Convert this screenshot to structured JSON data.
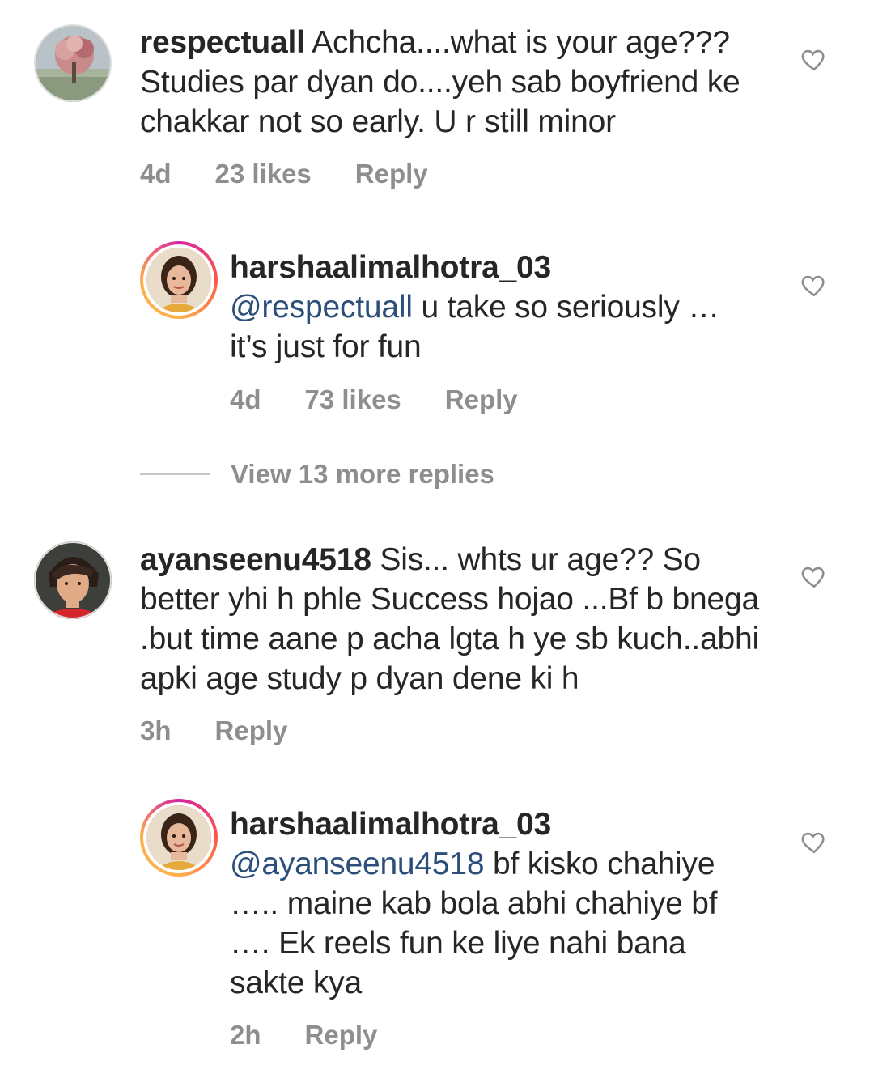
{
  "comments": [
    {
      "username": "respectuall",
      "text": "Achcha....what is your age??? Studies par dyan do....yeh sab boyfriend ke chakkar not so early. U r still minor",
      "time": "4d",
      "likes": "23 likes",
      "reply": "Reply"
    },
    {
      "username": "harshaalimalhotra_03",
      "mention": "@respectuall",
      "text": "u take so seriously … it’s just for fun",
      "time": "4d",
      "likes": "73 likes",
      "reply": "Reply"
    },
    {
      "username": "ayanseenu4518",
      "text": "Sis... whts ur age?? So better yhi h phle Success hojao ...Bf b bnega .but time aane p acha lgta h  ye sb kuch..abhi apki age study p dyan dene ki h",
      "time": "3h",
      "reply": "Reply"
    },
    {
      "username": "harshaalimalhotra_03",
      "mention": "@ayanseenu4518",
      "text": "bf kisko chahiye ….. maine kab bola abhi chahiye bf …. Ek reels fun ke liye nahi bana sakte kya",
      "time": "2h",
      "reply": "Reply"
    }
  ],
  "view_more_replies": "View 13 more replies",
  "icons": {
    "like": "heart-outline-icon",
    "avatar_1": "painted-tree-avatar",
    "avatar_2": "girl-portrait-avatar",
    "avatar_3": "boy-portrait-avatar"
  },
  "colors": {
    "mention": "#2b4f7a",
    "meta": "#8e8e8e",
    "text": "#262626"
  }
}
